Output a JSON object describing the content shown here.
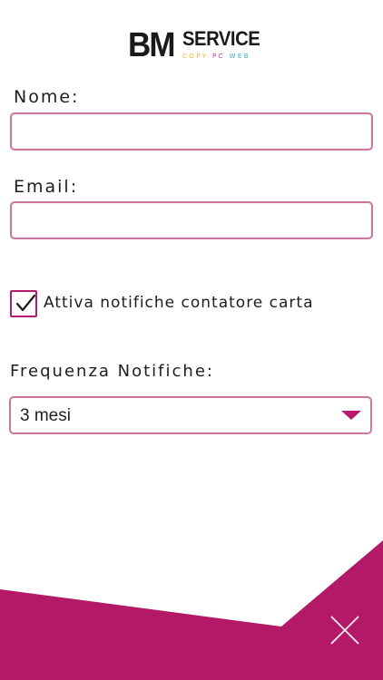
{
  "logo": {
    "bm": "BM",
    "service": "SERVICE",
    "tagline_copy": "COPY",
    "tagline_pc": "PC",
    "tagline_web": "WEB"
  },
  "form": {
    "name_label": "Nome:",
    "name_value": "",
    "email_label": "Email:",
    "email_value": "",
    "notify_checked": true,
    "notify_label": "Attiva notifiche contatore carta",
    "frequency_label": "Frequenza Notifiche:",
    "frequency_selected": "3 mesi"
  },
  "colors": {
    "accent": "#b81a6b",
    "field_border": "#c9779f"
  },
  "icons": {
    "close": "close-icon",
    "check": "checkmark-icon",
    "dropdown": "chevron-down-icon"
  }
}
